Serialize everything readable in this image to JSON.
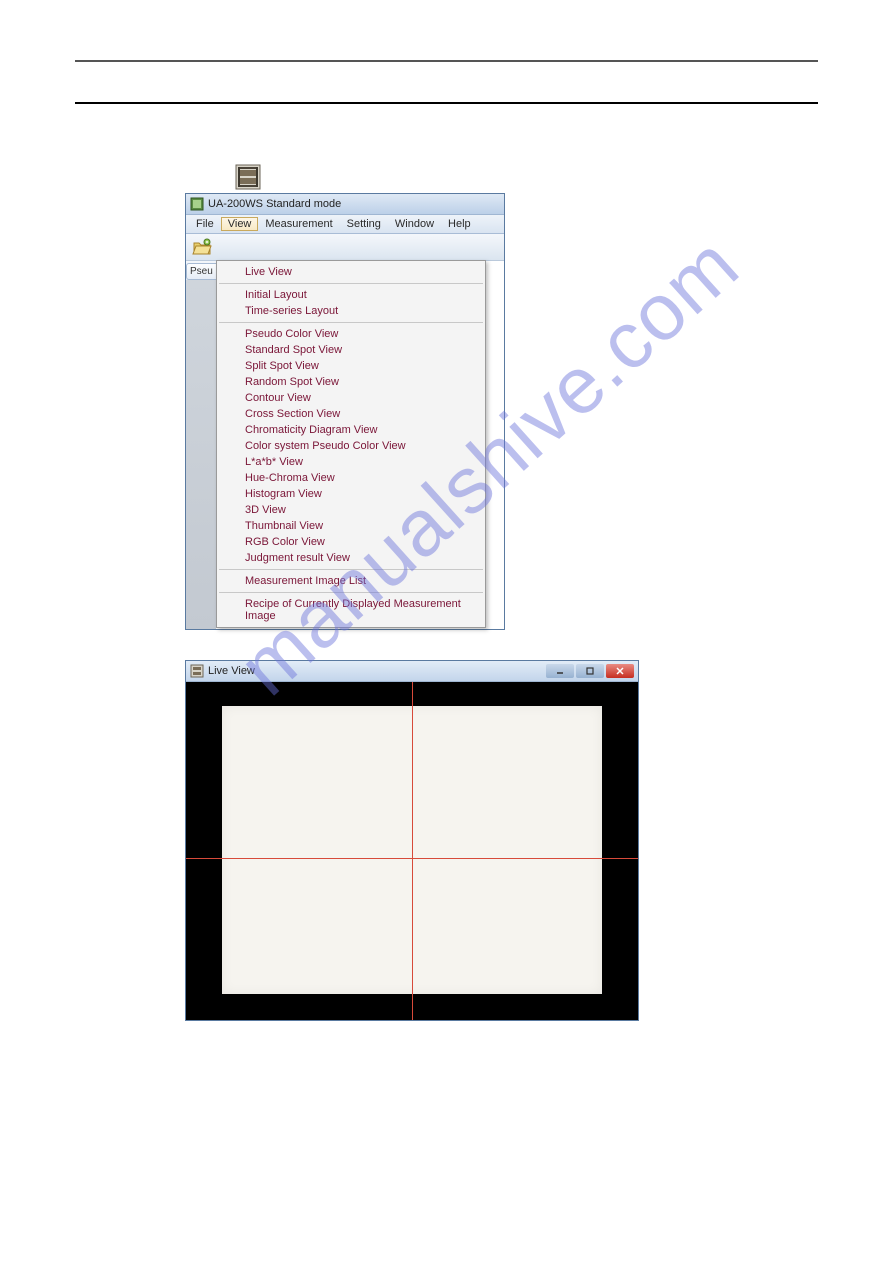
{
  "watermark": "manualshive.com",
  "app": {
    "title": "UA-200WS Standard mode",
    "menubar": {
      "file": "File",
      "view": "View",
      "measurement": "Measurement",
      "setting": "Setting",
      "window": "Window",
      "help": "Help"
    },
    "side_tab": "Pseu",
    "view_menu": {
      "group1": [
        "Live View"
      ],
      "group2": [
        "Initial Layout",
        "Time-series Layout"
      ],
      "group3": [
        "Pseudo Color View",
        "Standard Spot View",
        "Split Spot View",
        "Random Spot View",
        "Contour View",
        "Cross Section View",
        "Chromaticity Diagram View",
        "Color system Pseudo Color View",
        "L*a*b* View",
        "Hue-Chroma View",
        "Histogram View",
        "3D View",
        "Thumbnail View",
        "RGB Color View",
        "Judgment result View"
      ],
      "group4": [
        "Measurement Image List"
      ],
      "group5": [
        "Recipe of Currently Displayed Measurement Image"
      ]
    }
  },
  "liveview": {
    "title": "Live View"
  }
}
